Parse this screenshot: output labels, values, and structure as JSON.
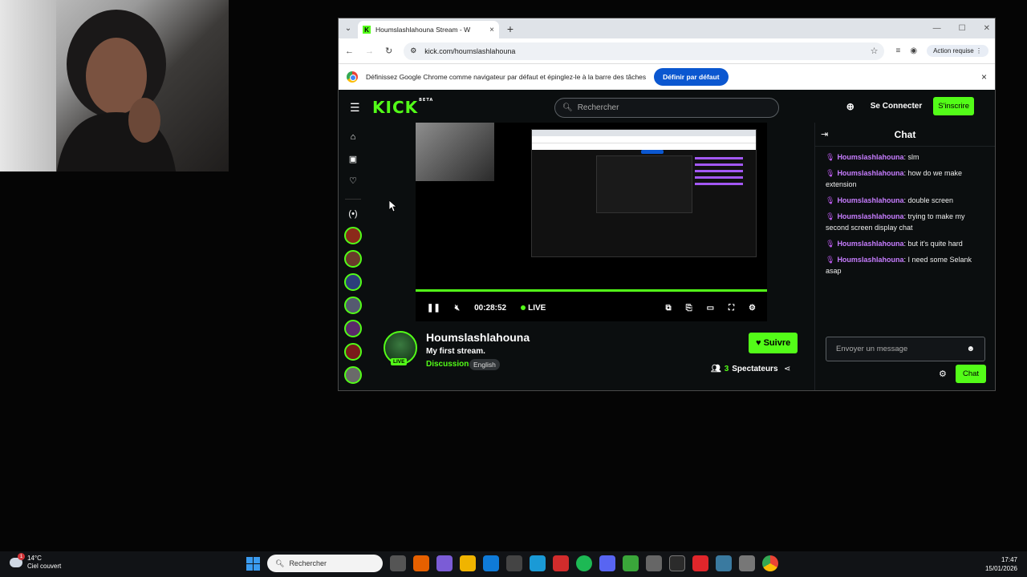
{
  "browser": {
    "tab_title": "Houmslashlahouna Stream - W",
    "tab_close": "×",
    "new_tab": "+",
    "url": "kick.com/houmslashlahouna",
    "action_label": "Action requise",
    "infobar_text": "Définissez Google Chrome comme navigateur par défaut et épinglez-le à la barre des tâches",
    "infobar_button": "Définir par défaut",
    "infobar_close": "×"
  },
  "kick": {
    "logo": "KICK",
    "logo_badge": "BETA",
    "search_placeholder": "Rechercher",
    "login": "Se Connecter",
    "signup": "S'inscrire",
    "player": {
      "time": "00:28:52",
      "live_label": "LIVE",
      "progress": 1.0
    },
    "stream": {
      "streamer": "Houmslashlahouna",
      "title": "My first stream.",
      "category": "Discussion",
      "language": "English",
      "live_badge": "LIVE",
      "follow": "Suivre",
      "viewer_count": "3",
      "viewer_label": "Spectateurs"
    },
    "chat": {
      "title": "Chat",
      "messages": [
        {
          "user": "Houmslashlahouna",
          "text": ": slm"
        },
        {
          "user": "Houmslashlahouna",
          "text": ": how do we make extension"
        },
        {
          "user": "Houmslashlahouna",
          "text": ": double screen"
        },
        {
          "user": "Houmslashlahouna",
          "text": ": trying to make my second screen display chat"
        },
        {
          "user": "Houmslashlahouna",
          "text": ": but it's quite hard"
        },
        {
          "user": "Houmslashlahouna",
          "text": ": I need some Selank asap"
        }
      ],
      "input_placeholder": "Envoyer un message",
      "send_button": "Chat"
    }
  },
  "taskbar": {
    "weather_temp": "14°C",
    "weather_desc": "Ciel couvert",
    "notif_count": "1",
    "search_placeholder": "Rechercher",
    "time": "17:47",
    "date": "15/01/2026"
  },
  "colors": {
    "kick_green": "#53fc18",
    "chat_user": "#c77dff",
    "chrome_blue": "#0b57d0"
  }
}
